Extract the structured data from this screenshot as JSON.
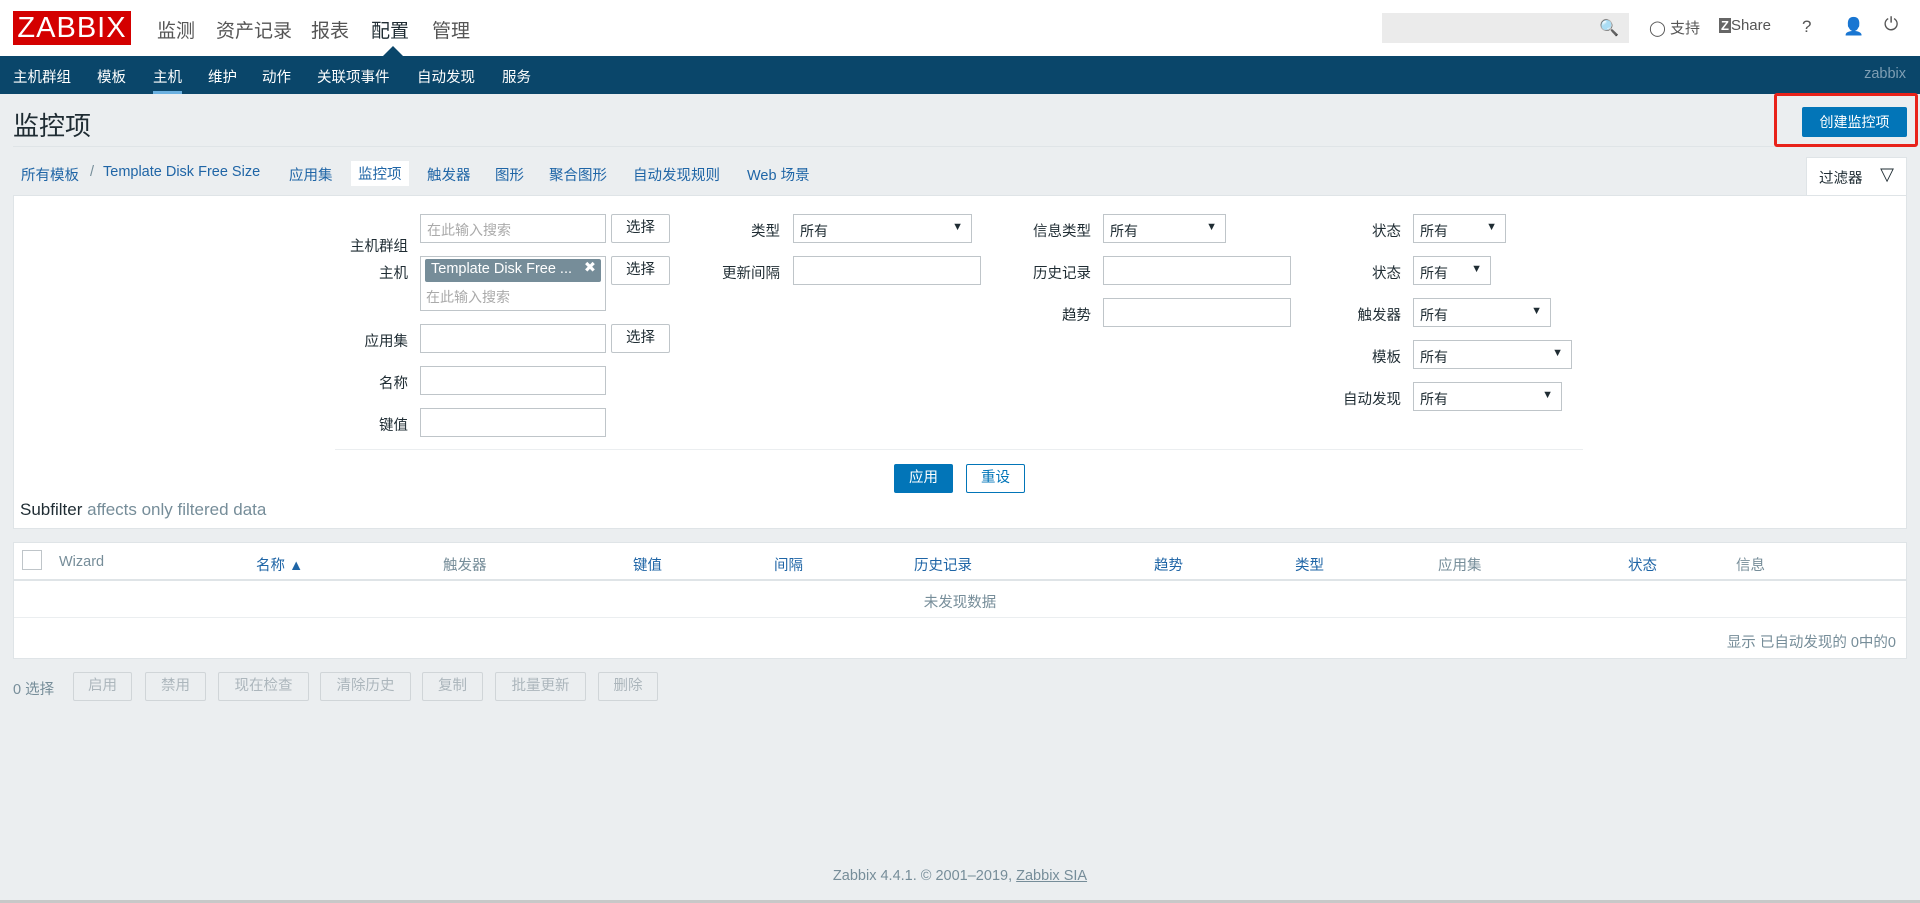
{
  "header": {
    "logo": "ZABBIX",
    "menu": [
      "监测",
      "资产记录",
      "报表",
      "配置",
      "管理"
    ],
    "active_menu": "配置",
    "support": "支持",
    "share": "Share",
    "help": "?"
  },
  "subnav": {
    "items": [
      "主机群组",
      "模板",
      "主机",
      "维护",
      "动作",
      "关联项事件",
      "自动发现",
      "服务"
    ],
    "active": "主机",
    "user": "zabbix"
  },
  "page": {
    "title": "监控项",
    "create_button": "创建监控项"
  },
  "breadcrumb": {
    "all_templates": "所有模板",
    "separator": "/",
    "template": "Template Disk Free Size",
    "tabs": [
      "应用集",
      "监控项",
      "触发器",
      "图形",
      "聚合图形",
      "自动发现规则",
      "Web 场景"
    ],
    "active": "监控项"
  },
  "filter": {
    "tab_label": "过滤器",
    "host_group": {
      "label": "主机群组",
      "placeholder": "在此输入搜索",
      "button": "选择"
    },
    "host": {
      "label": "主机",
      "tag": "Template Disk Free ...",
      "placeholder": "在此输入搜索",
      "button": "选择"
    },
    "application": {
      "label": "应用集",
      "button": "选择"
    },
    "name": {
      "label": "名称"
    },
    "key": {
      "label": "键值"
    },
    "type": {
      "label": "类型",
      "value": "所有"
    },
    "update_interval": {
      "label": "更新间隔"
    },
    "info_type": {
      "label": "信息类型",
      "value": "所有"
    },
    "history": {
      "label": "历史记录"
    },
    "trends": {
      "label": "趋势"
    },
    "state": {
      "label": "状态",
      "value": "所有"
    },
    "status": {
      "label": "状态",
      "value": "所有"
    },
    "triggers": {
      "label": "触发器",
      "value": "所有"
    },
    "template": {
      "label": "模板",
      "value": "所有"
    },
    "discovered": {
      "label": "自动发现",
      "value": "所有"
    },
    "apply": "应用",
    "reset": "重设",
    "subfilter": "Subfilter",
    "subfilter_note": "affects only filtered data"
  },
  "table": {
    "columns": [
      "Wizard",
      "名称 ▲",
      "触发器",
      "键值",
      "间隔",
      "历史记录",
      "趋势",
      "类型",
      "应用集",
      "状态",
      "信息"
    ],
    "empty": "未发现数据",
    "paging": "显示 已自动发现的 0中的0"
  },
  "actions": {
    "selected": "0 选择",
    "buttons": [
      "启用",
      "禁用",
      "现在检查",
      "清除历史",
      "复制",
      "批量更新",
      "删除"
    ]
  },
  "footer": {
    "text": "Zabbix 4.4.1. © 2001–2019,",
    "link": "Zabbix SIA"
  }
}
